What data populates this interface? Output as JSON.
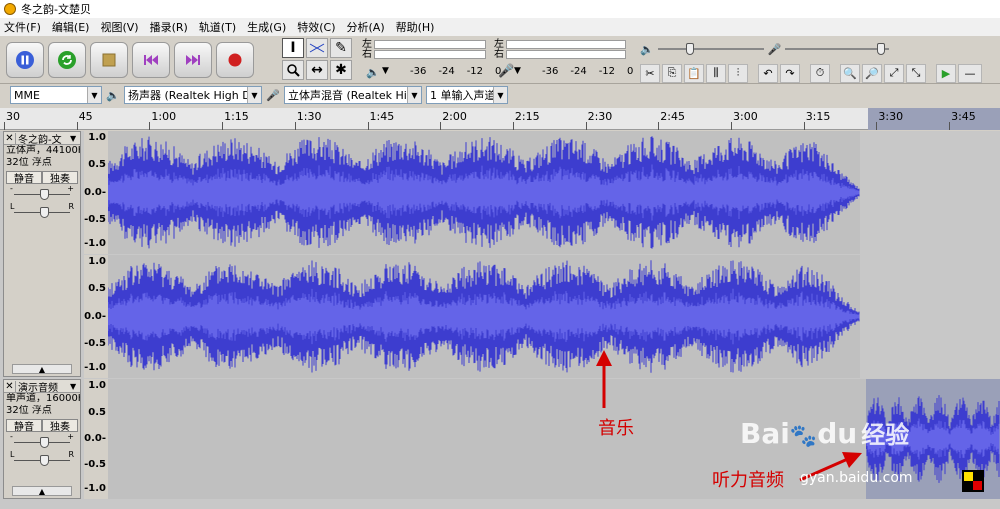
{
  "window": {
    "title": "冬之韵-文楚贝"
  },
  "menu": [
    "文件(F)",
    "编辑(E)",
    "视图(V)",
    "播录(R)",
    "轨道(T)",
    "生成(G)",
    "特效(C)",
    "分析(A)",
    "帮助(H)"
  ],
  "transport": {
    "buttons": [
      {
        "name": "pause-button",
        "icon": "pause-icon",
        "color": "#3a5fd8"
      },
      {
        "name": "loop-button",
        "icon": "loop-icon",
        "color": "#2aa02a"
      },
      {
        "name": "stop-button",
        "icon": "stop-icon",
        "color": "#c0a050"
      },
      {
        "name": "skip-start-button",
        "icon": "skip-start-icon",
        "color": "#a040c0"
      },
      {
        "name": "skip-end-button",
        "icon": "skip-end-icon",
        "color": "#a040c0"
      },
      {
        "name": "record-button",
        "icon": "record-icon",
        "color": "#d02020"
      }
    ]
  },
  "meters": {
    "left": "左",
    "right": "右",
    "scale_play": [
      "-36",
      "-24",
      "-12",
      "0"
    ],
    "scale_rec": [
      "-36",
      "-24",
      "-12",
      "0"
    ]
  },
  "devices": {
    "host": "MME",
    "output": "扬声器 (Realtek High Defin",
    "input_mix": "立体声混音 (Realtek High D",
    "channels": "1 单输入声道"
  },
  "ruler": {
    "labels": [
      {
        "t": "30",
        "sel": false
      },
      {
        "t": "45",
        "sel": false
      },
      {
        "t": "1:00",
        "sel": false
      },
      {
        "t": "1:15",
        "sel": false
      },
      {
        "t": "1:30",
        "sel": false
      },
      {
        "t": "1:45",
        "sel": false
      },
      {
        "t": "2:00",
        "sel": false
      },
      {
        "t": "2:15",
        "sel": false
      },
      {
        "t": "2:30",
        "sel": false
      },
      {
        "t": "2:45",
        "sel": false
      },
      {
        "t": "3:00",
        "sel": false
      },
      {
        "t": "3:15",
        "sel": false
      },
      {
        "t": "3:30",
        "sel": true
      },
      {
        "t": "3:45",
        "sel": true
      }
    ]
  },
  "tracks": [
    {
      "name": "冬之韵-文",
      "info1": "立体声，44100Hz",
      "info2": "32位 浮点",
      "mute": "静音",
      "solo": "独奏",
      "scale": [
        "1.0",
        "0.5",
        "0.0-",
        "-0.5",
        "-1.0"
      ]
    },
    {
      "name": "演示音频",
      "info1": "单声道，16000Hz",
      "info2": "32位 浮点",
      "mute": "静音",
      "solo": "独奏",
      "scale": [
        "1.0",
        "0.5",
        "0.0-",
        "-0.5",
        "-1.0"
      ]
    }
  ],
  "annotations": {
    "music": "音乐",
    "listening": "听力音频",
    "color": "#d40000"
  },
  "watermark": {
    "brand": "Bai",
    "paw": "du",
    "jingyan": "经验",
    "url": "gyan.baidu.com"
  },
  "colors": {
    "waveform": "#3d3dcf",
    "waveform_rms": "#6464e8",
    "selection": "#9aa0b8"
  }
}
